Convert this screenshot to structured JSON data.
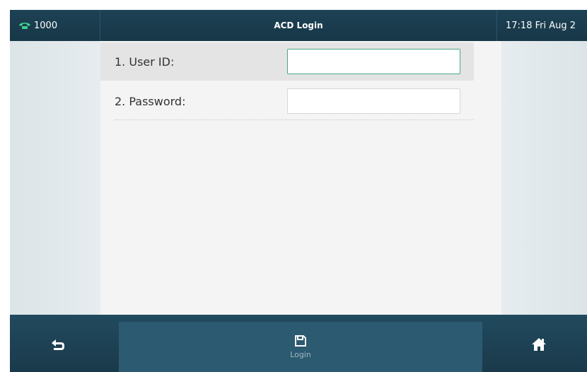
{
  "status_bar": {
    "line": "1000",
    "title": "ACD Login",
    "datetime": "17:18 Fri Aug 2"
  },
  "form": {
    "fields": [
      {
        "label": "1. User ID:",
        "value": "",
        "placeholder": ""
      },
      {
        "label": "2. Password:",
        "value": "",
        "placeholder": ""
      }
    ]
  },
  "softkeys": {
    "back_icon": "back-arrow-icon",
    "login_label": "Login",
    "login_icon": "save-icon",
    "home_icon": "home-icon"
  },
  "colors": {
    "header_bg": "#1b3c4d",
    "accent_green": "#4aa78a",
    "softkey_active": "#2c5a70"
  }
}
